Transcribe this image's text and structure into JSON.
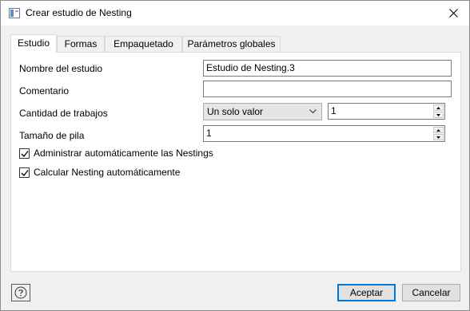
{
  "window": {
    "title": "Crear estudio de Nesting",
    "icon": "window-app-icon",
    "close_icon": "close-icon"
  },
  "tabs": [
    {
      "label": "Estudio",
      "active": true
    },
    {
      "label": "Formas",
      "active": false
    },
    {
      "label": "Empaquetado",
      "active": false
    },
    {
      "label": "Parámetros globales",
      "active": false
    }
  ],
  "form": {
    "study_name_label": "Nombre del estudio",
    "study_name_value": "Estudio de Nesting.3",
    "comment_label": "Comentario",
    "comment_value": "",
    "job_count_label": "Cantidad de trabajos",
    "job_count_mode": "Un solo valor",
    "job_count_value": "1",
    "stack_size_label": "Tamaño de pila",
    "stack_size_value": "1",
    "auto_manage_label": "Administrar automáticamente las Nestings",
    "auto_manage_checked": true,
    "auto_calc_label": "Calcular Nesting automáticamente",
    "auto_calc_checked": true
  },
  "footer": {
    "help_icon": "help-icon",
    "ok_label": "Aceptar",
    "cancel_label": "Cancelar"
  },
  "colors": {
    "primary_button_border": "#0078d7"
  }
}
